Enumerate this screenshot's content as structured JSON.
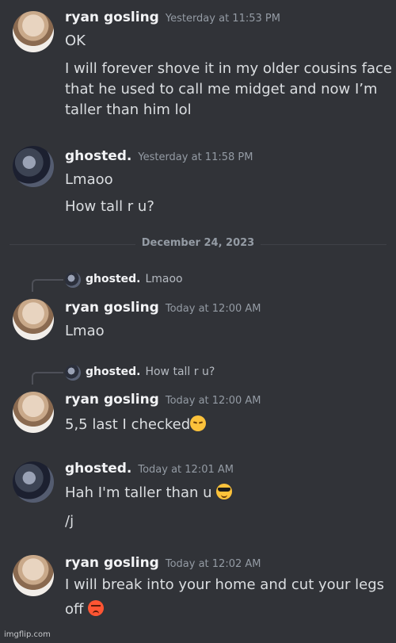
{
  "messages": [
    {
      "user": "ryan gosling",
      "timestamp": "Yesterday at 11:53 PM",
      "lines": [
        "OK",
        "I will forever shove it in my older cousins face",
        "that he used to call me midget and now I’m",
        "taller than him lol"
      ]
    },
    {
      "user": "ghosted.",
      "timestamp": "Yesterday at 11:58 PM",
      "lines": [
        "Lmaoo",
        "How tall r u?"
      ]
    },
    {
      "user": "ryan gosling",
      "timestamp": "Today at 12:00 AM",
      "reply_to": {
        "user": "ghosted.",
        "text": "Lmaoo"
      },
      "lines": [
        "Lmao"
      ]
    },
    {
      "user": "ryan gosling",
      "timestamp": "Today at 12:00 AM",
      "reply_to": {
        "user": "ghosted.",
        "text": "How tall r u?"
      },
      "lines": [
        "5,5 last I checked"
      ],
      "emoji": "pensive-face"
    },
    {
      "user": "ghosted.",
      "timestamp": "Today at 12:01 AM",
      "lines": [
        "Hah I'm taller than u ",
        "/j"
      ],
      "emoji": "sunglasses-face"
    },
    {
      "user": "ryan gosling",
      "timestamp": "Today at 12:02 AM",
      "lines": [
        "I will break into your home and cut your legs",
        "off "
      ],
      "emoji": "angry-face"
    }
  ],
  "date_divider": "December 24, 2023",
  "watermark": "imgflip.com"
}
